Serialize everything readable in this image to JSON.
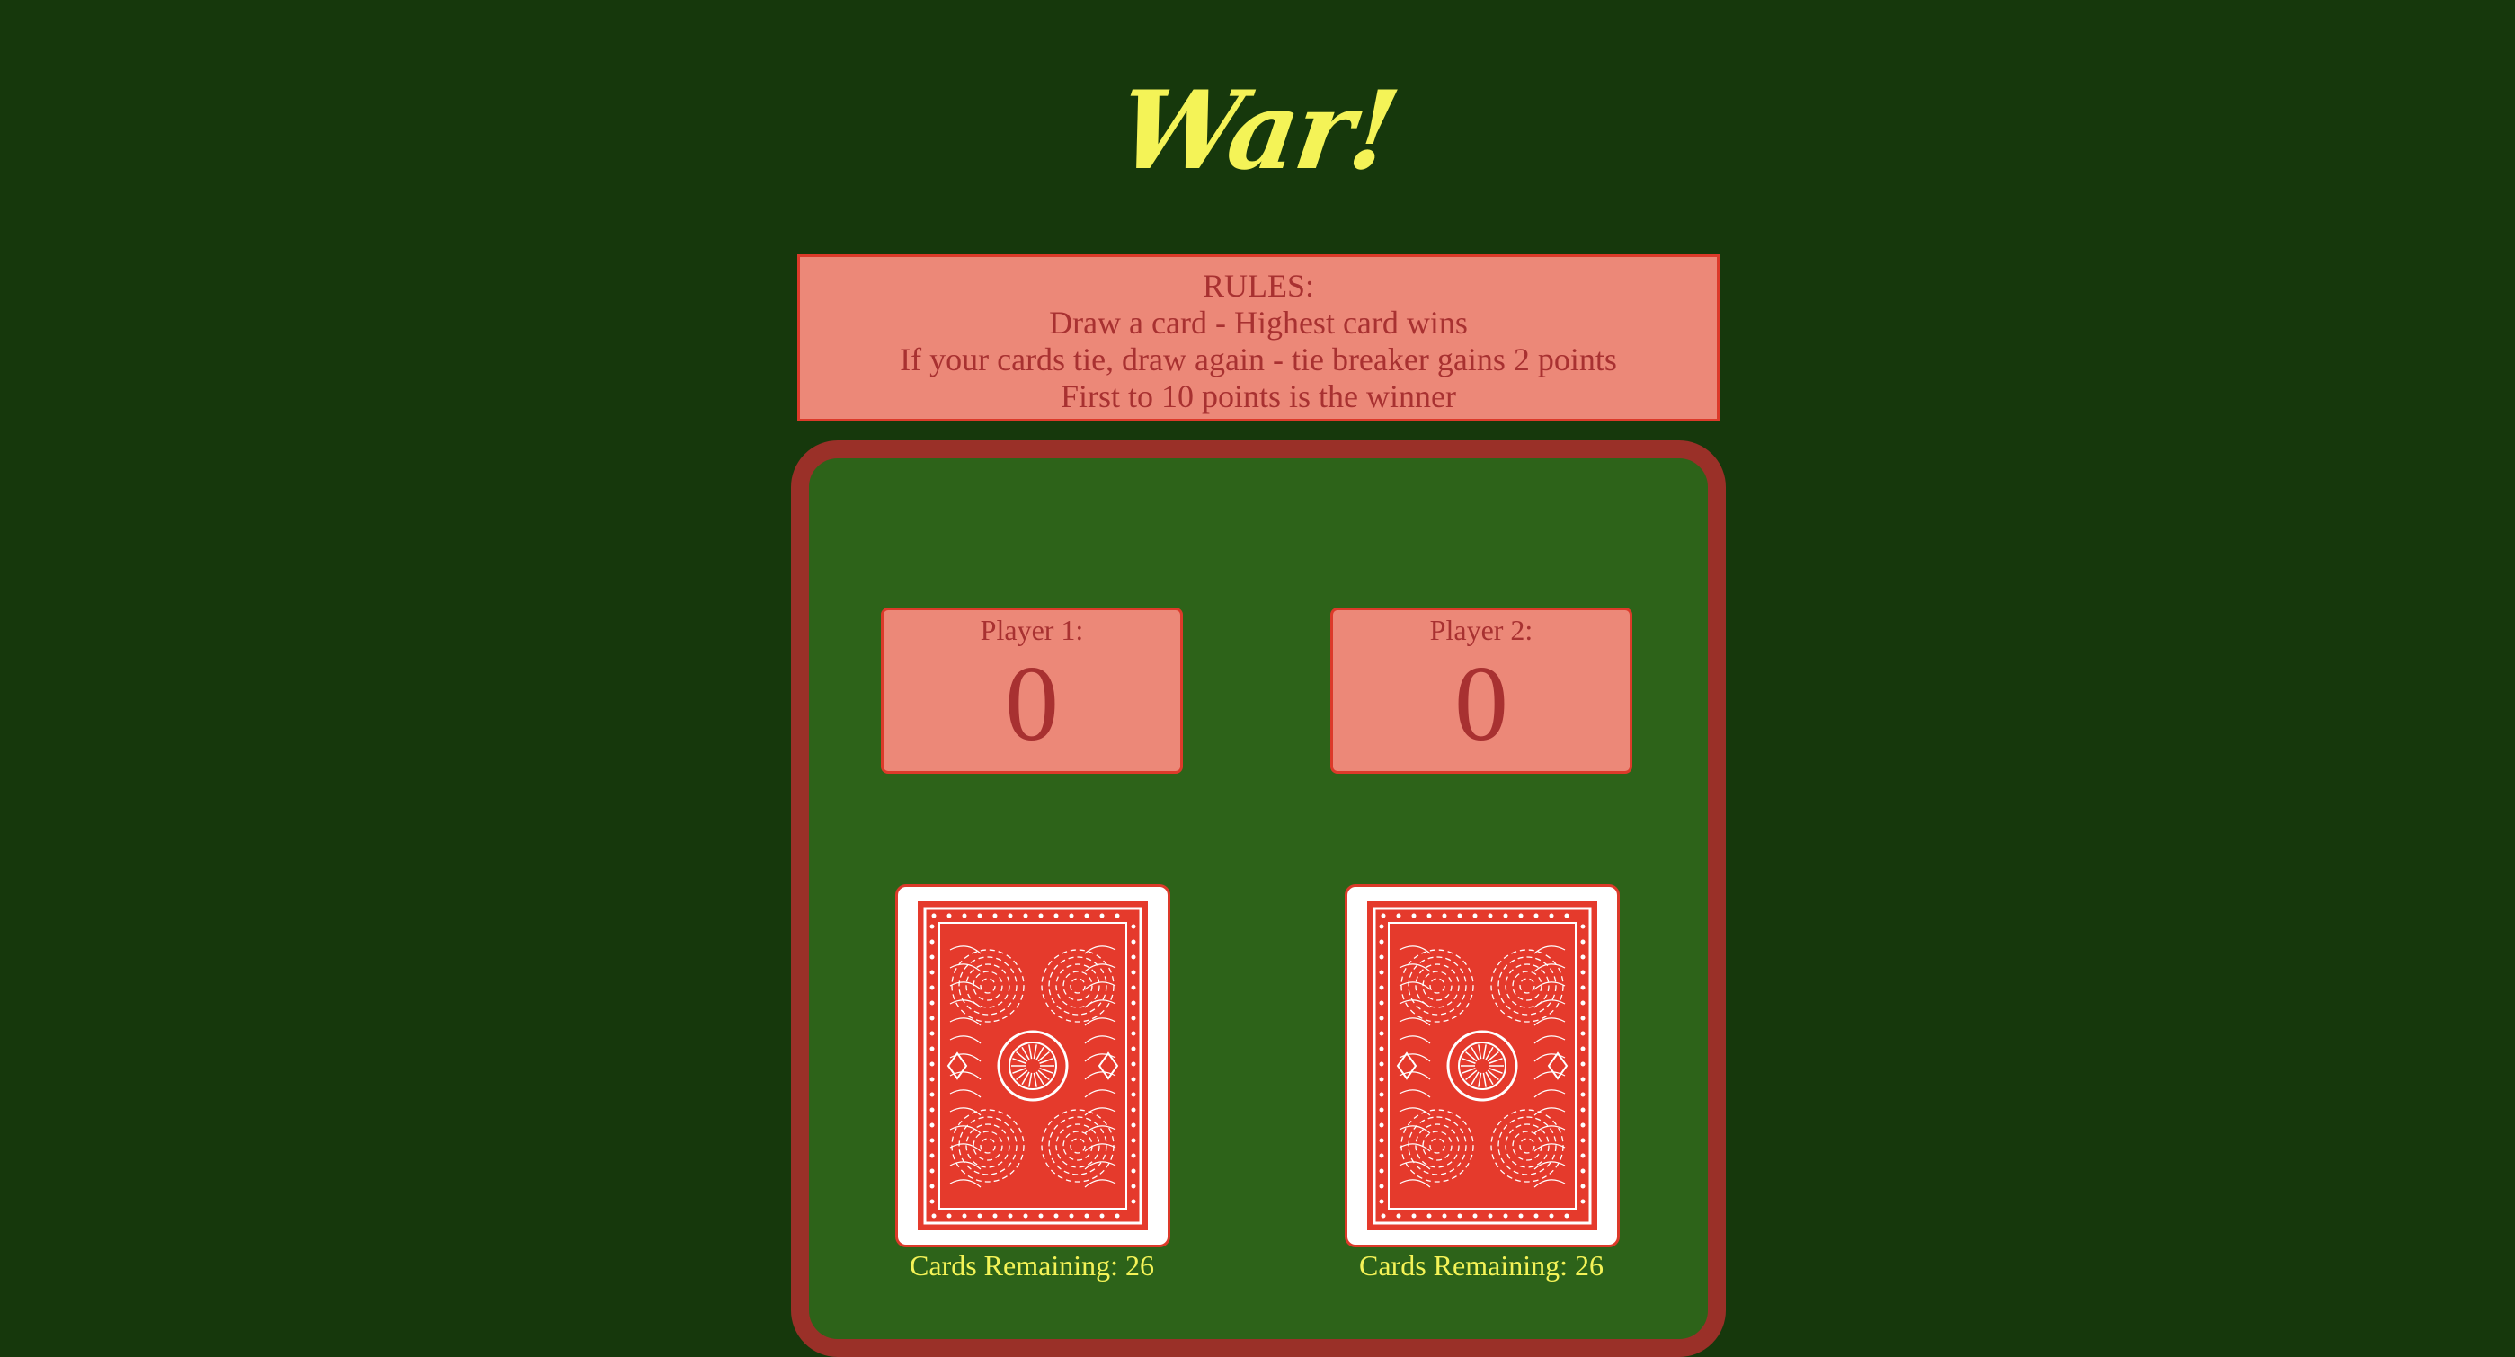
{
  "title": "War!",
  "rules": {
    "heading": "RULES:",
    "lines": [
      "Draw a card - Highest card wins",
      "If your cards tie, draw again - tie breaker gains 2 points",
      "First to 10 points is the winner"
    ]
  },
  "players": [
    {
      "label": "Player 1:",
      "score": "0",
      "cards_remaining": "Cards Remaining: 26",
      "card": "card-back-icon"
    },
    {
      "label": "Player 2:",
      "score": "0",
      "cards_remaining": "Cards Remaining: 26",
      "card": "card-back-icon"
    }
  ],
  "colors": {
    "background": "#16380c",
    "felt": "#2d6319",
    "table_border": "#9a3028",
    "panel": "#ec8878",
    "panel_border": "#dc3a2a",
    "panel_text": "#a83131",
    "accent_text": "#f4f357",
    "card_red": "#e53a2c"
  }
}
